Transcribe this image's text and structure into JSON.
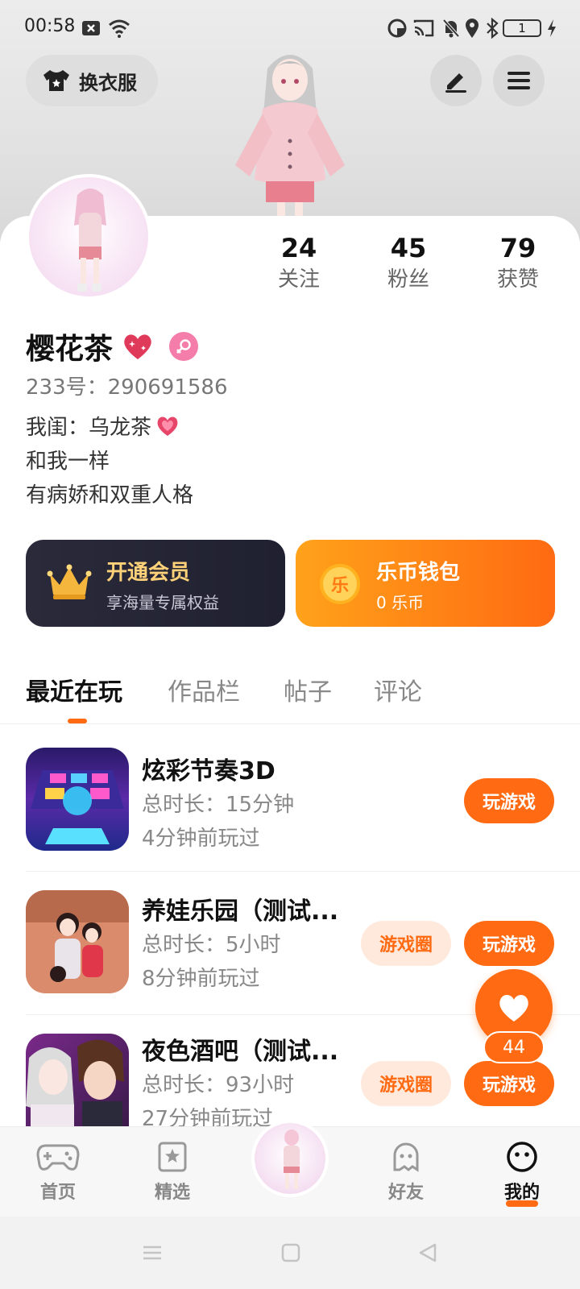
{
  "status_bar": {
    "time": "00:58",
    "battery_level": "1"
  },
  "header": {
    "outfit_button_label": "换衣服"
  },
  "profile": {
    "stats": [
      {
        "count": "24",
        "label": "关注"
      },
      {
        "count": "45",
        "label": "粉丝"
      },
      {
        "count": "79",
        "label": "获赞"
      }
    ],
    "name": "樱花茶",
    "id_line": "233号：290691586",
    "bio_lines": [
      "我闺：乌龙茶",
      "和我一样",
      "有病娇和双重人格"
    ]
  },
  "vip_card": {
    "title": "开通会员",
    "subtitle": "享海量专属权益",
    "title_color": "#ffd27a"
  },
  "wallet_card": {
    "coin_glyph": "乐",
    "title": "乐币钱包",
    "subtitle": "0 乐币"
  },
  "tabs": [
    "最近在玩",
    "作品栏",
    "帖子",
    "评论"
  ],
  "games": [
    {
      "title": "炫彩节奏3D",
      "duration": "总时长：15分钟",
      "last_played": "4分钟前玩过",
      "circle_label": "",
      "play_label": "玩游戏"
    },
    {
      "title": "养娃乐园（测试...",
      "duration": "总时长：5小时",
      "last_played": "8分钟前玩过",
      "circle_label": "游戏圈",
      "play_label": "玩游戏"
    },
    {
      "title": "夜色酒吧（测试...",
      "duration": "总时长：93小时",
      "last_played": "27分钟前玩过",
      "circle_label": "游戏圈",
      "play_label": "玩游戏"
    }
  ],
  "like_float": {
    "count": "44"
  },
  "bottom_nav": [
    {
      "label": "首页",
      "icon": "gamepad-icon"
    },
    {
      "label": "精选",
      "icon": "star-bookmark-icon"
    },
    {
      "label": "",
      "icon": "avatar"
    },
    {
      "label": "好友",
      "icon": "ghost-icon"
    },
    {
      "label": "我的",
      "icon": "smile-face-icon"
    }
  ],
  "colors": {
    "accent": "#ff6a12",
    "accent_light": "#ffe9dc",
    "vip_bg": "#23243a"
  }
}
